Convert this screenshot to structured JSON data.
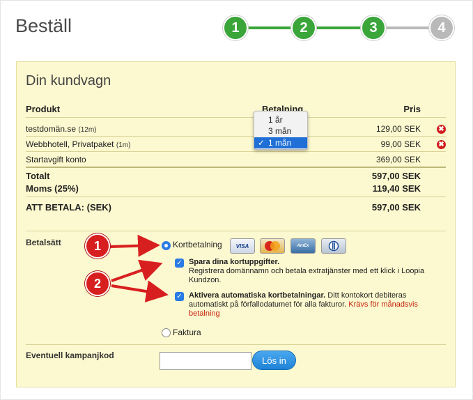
{
  "page": {
    "title": "Beställ"
  },
  "stepper": {
    "steps": [
      "1",
      "2",
      "3",
      "4"
    ],
    "active_color": "#3aa63a",
    "inactive_color": "#b9b9b9"
  },
  "cart": {
    "title": "Din kundvagn",
    "headers": {
      "product": "Produkt",
      "payment": "Betalning",
      "price": "Pris"
    },
    "items": [
      {
        "name": "testdomän.se",
        "term": "(12m)",
        "price": "129,00 SEK",
        "removable": true
      },
      {
        "name": "Webbhotell, Privatpaket",
        "term": "(1m)",
        "price": "99,00 SEK",
        "removable": true
      },
      {
        "name": "Startavgift konto",
        "term": "",
        "price": "369,00 SEK",
        "removable": false
      }
    ],
    "total_label": "Totalt",
    "total_value": "597,00 SEK",
    "vat_label": "Moms (25%)",
    "vat_value": "119,40 SEK",
    "pay_label": "ATT BETALA: (SEK)",
    "pay_value": "597,00 SEK",
    "payment_dropdown": {
      "options": [
        "1 år",
        "3 mån",
        "1 mån"
      ],
      "selected": "1 mån",
      "check_mark": "✓"
    }
  },
  "payment": {
    "label": "Betalsätt",
    "card_option": "Kortbetalning",
    "cards": [
      "VISA",
      "MasterCard",
      "AmEx",
      "Diners"
    ],
    "save_card_title": "Spara dina kortuppgifter.",
    "save_card_text": "Registrera domännamn och betala extratjänster med ett klick i Loopia Kundzon.",
    "auto_title": "Aktivera automatiska kortbetalningar.",
    "auto_text": "Ditt kontokort debiteras automatiskt på förfallodatumet för alla fakturor.",
    "auto_note": "Krävs för månadsvis betalning",
    "invoice_option": "Faktura"
  },
  "campaign": {
    "label": "Eventuell kampanjkod",
    "input_value": "",
    "button_label": "Lös in"
  },
  "annotations": {
    "badge1": "1",
    "badge2": "2",
    "color": "#d81f1f"
  },
  "icons": {
    "remove": "✖"
  }
}
